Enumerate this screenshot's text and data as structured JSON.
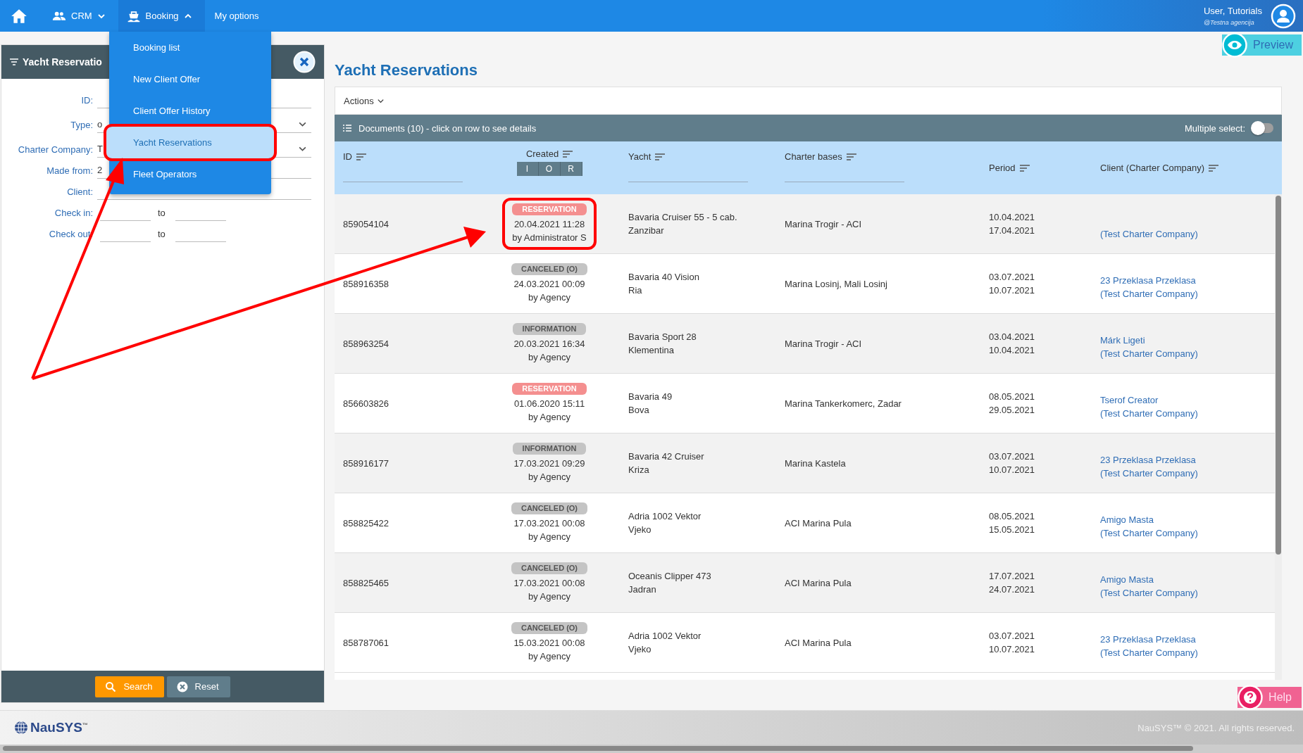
{
  "top_bar": {
    "menus": [
      {
        "label": "CRM",
        "expanded": false
      },
      {
        "label": "Booking",
        "expanded": true
      }
    ],
    "link": "My options",
    "user": {
      "name": "User, Tutorials",
      "agency": "@Testna agencija"
    }
  },
  "booking_menu": [
    {
      "label": "Booking list",
      "selected": false,
      "highlighted": false
    },
    {
      "label": "New Client Offer",
      "selected": false,
      "highlighted": false
    },
    {
      "label": "Client Offer History",
      "selected": false,
      "highlighted": false
    },
    {
      "label": "Yacht Reservations",
      "selected": true,
      "highlighted": true
    },
    {
      "label": "Fleet Operators",
      "selected": false,
      "highlighted": false
    }
  ],
  "filter_panel": {
    "title": "Yacht Reservatio",
    "fields": [
      {
        "label": "ID:",
        "kind": "input"
      },
      {
        "label": "Type:",
        "kind": "select",
        "value": "o"
      },
      {
        "label": "Charter Company:",
        "kind": "select",
        "value": "T"
      },
      {
        "label": "Made from:",
        "kind": "input",
        "value": "2"
      },
      {
        "label": "Client:",
        "kind": "input"
      },
      {
        "label": "Check in:",
        "kind": "range",
        "separator": "to"
      },
      {
        "label": "Check out:",
        "kind": "range",
        "separator": "to"
      }
    ],
    "buttons": [
      {
        "label": "Search",
        "kind": "primary"
      },
      {
        "label": "Reset",
        "kind": "secondary"
      }
    ]
  },
  "preview_button": "Preview",
  "page_title": "Yacht Reservations",
  "actions_menu": "Actions",
  "documents": {
    "title": "Documents (10) - click on row to see details",
    "multiple_select": {
      "label": "Multiple select:",
      "on": false
    }
  },
  "columns": [
    {
      "label": "ID",
      "kind": "filter"
    },
    {
      "label": "Created",
      "kind": "segments",
      "segments": [
        "I",
        "O",
        "R"
      ]
    },
    {
      "label": "Yacht",
      "kind": "filter"
    },
    {
      "label": "Charter bases",
      "kind": "filter"
    },
    {
      "label": "Period",
      "kind": "plain"
    },
    {
      "label": "Client (Charter Company)",
      "kind": "plain"
    }
  ],
  "rows": [
    {
      "id": "859054104",
      "status": "RESERVATION",
      "kind": "reservation",
      "created": "20.04.2021 11:28",
      "by": "by Administrator S",
      "yacht": "Bavaria Cruiser 55 - 5 cab.",
      "yacht_name": "Zanzibar",
      "base": "Marina Trogir - ACI",
      "from": "10.04.2021",
      "to": "17.04.2021",
      "company": "(Test Charter Company)",
      "highlighted": true
    },
    {
      "id": "858916358",
      "status": "CANCELED (O)",
      "kind": "canceled",
      "created": "24.03.2021 00:09",
      "by": "by Agency",
      "yacht": "Bavaria 40 Vision",
      "yacht_name": "Ria",
      "base": "Marina Losinj, Mali Losinj",
      "from": "03.07.2021",
      "to": "10.07.2021",
      "client": "23 Przeklasa Przeklasa",
      "company": "(Test Charter Company)",
      "highlighted": false
    },
    {
      "id": "858963254",
      "status": "INFORMATION",
      "kind": "information",
      "created": "20.03.2021 16:34",
      "by": "by Agency",
      "yacht": "Bavaria Sport 28",
      "yacht_name": "Klementina",
      "base": "Marina Trogir - ACI",
      "from": "03.04.2021",
      "to": "10.04.2021",
      "client": "Márk Ligeti",
      "company": "(Test Charter Company)",
      "highlighted": false
    },
    {
      "id": "856603826",
      "status": "RESERVATION",
      "kind": "reservation",
      "created": "01.06.2020 15:11",
      "by": "by Agency",
      "yacht": "Bavaria 49",
      "yacht_name": "Bova",
      "base": "Marina Tankerkomerc, Zadar",
      "from": "08.05.2021",
      "to": "29.05.2021",
      "client": "Tserof Creator",
      "company": "(Test Charter Company)",
      "highlighted": false
    },
    {
      "id": "858916177",
      "status": "INFORMATION",
      "kind": "information",
      "created": "17.03.2021 09:29",
      "by": "by Agency",
      "yacht": "Bavaria 42 Cruiser",
      "yacht_name": "Kriza",
      "base": "Marina Kastela",
      "from": "03.07.2021",
      "to": "10.07.2021",
      "client": "23 Przeklasa Przeklasa",
      "company": "(Test Charter Company)",
      "highlighted": false
    },
    {
      "id": "858825422",
      "status": "CANCELED (O)",
      "kind": "canceled",
      "created": "17.03.2021 00:08",
      "by": "by Agency",
      "yacht": "Adria 1002 Vektor",
      "yacht_name": "Vjeko",
      "base": "ACI Marina Pula",
      "from": "08.05.2021",
      "to": "15.05.2021",
      "client": "Amigo Masta",
      "company": "(Test Charter Company)",
      "highlighted": false
    },
    {
      "id": "858825465",
      "status": "CANCELED (O)",
      "kind": "canceled",
      "created": "17.03.2021 00:08",
      "by": "by Agency",
      "yacht": "Oceanis Clipper 473",
      "yacht_name": "Jadran",
      "base": "ACI Marina Pula",
      "from": "17.07.2021",
      "to": "24.07.2021",
      "client": "Amigo Masta",
      "company": "(Test Charter Company)",
      "highlighted": false
    },
    {
      "id": "858787061",
      "status": "CANCELED (O)",
      "kind": "canceled",
      "created": "15.03.2021 00:08",
      "by": "by Agency",
      "yacht": "Adria 1002 Vektor",
      "yacht_name": "Vjeko",
      "base": "ACI Marina Pula",
      "from": "03.07.2021",
      "to": "10.07.2021",
      "client": "23 Przeklasa Przeklasa",
      "company": "(Test Charter Company)",
      "highlighted": false
    }
  ],
  "help_button": "Help",
  "footer": {
    "logo": "NauSYS",
    "logo_mark": "™",
    "copyright": "NauSYS™ © 2021. All rights reserved."
  }
}
